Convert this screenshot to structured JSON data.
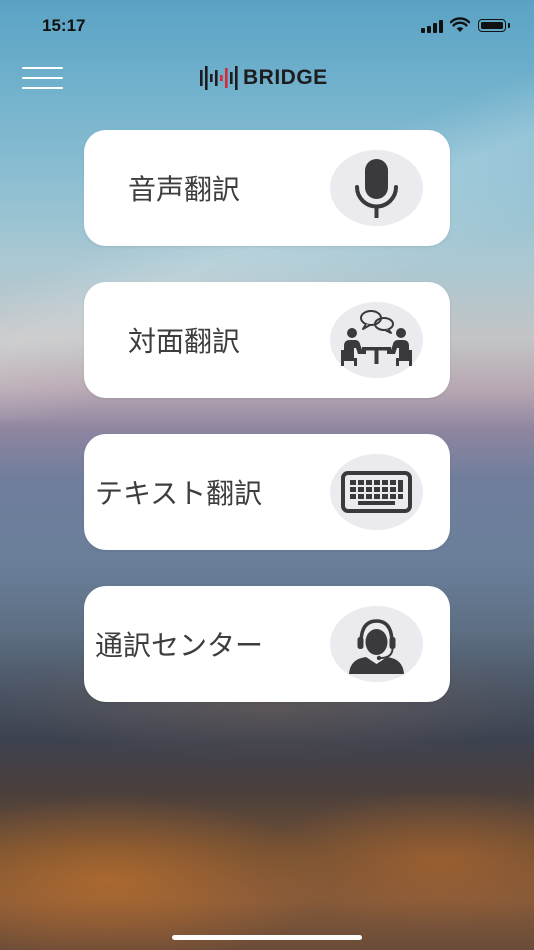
{
  "status_bar": {
    "time": "15:17",
    "icons": [
      "cellular-signal-icon",
      "wifi-icon",
      "battery-icon"
    ]
  },
  "header": {
    "menu_icon": "hamburger-menu-icon",
    "brand_text": "BRIDGE",
    "brand_mark_icon": "sound-wave-logo-icon",
    "colors": {
      "brand_dark": "#1d1d1f",
      "brand_accent": "#d62a35"
    }
  },
  "menu": {
    "items": [
      {
        "label": "音声翻訳",
        "icon": "microphone-icon"
      },
      {
        "label": "対面翻訳",
        "icon": "face-to-face-conversation-icon"
      },
      {
        "label": "テキスト翻訳",
        "icon": "keyboard-icon"
      },
      {
        "label": "通訳センター",
        "icon": "operator-headset-icon"
      }
    ]
  },
  "colors": {
    "card_background": "#ffffff",
    "icon_circle": "#ebebef",
    "icon_glyph": "#3a3a3c",
    "label_text": "#3d3d3d"
  }
}
